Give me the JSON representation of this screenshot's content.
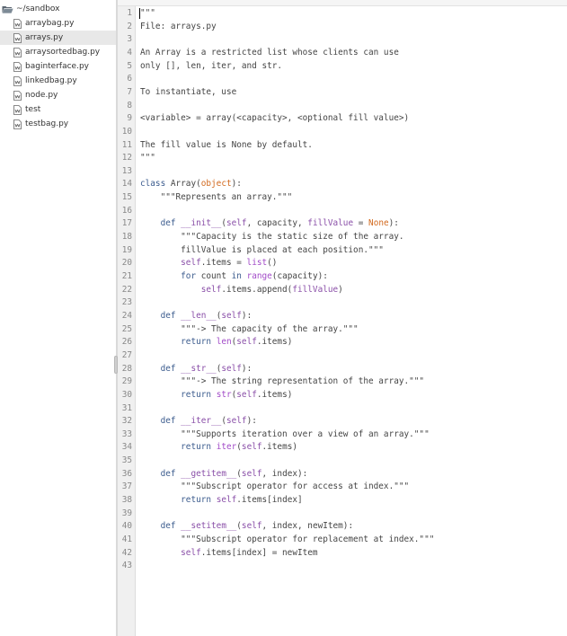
{
  "sidebar": {
    "root": "~/sandbox",
    "files": [
      {
        "name": "arraybag.py",
        "selected": false
      },
      {
        "name": "arrays.py",
        "selected": true
      },
      {
        "name": "arraysortedbag.py",
        "selected": false
      },
      {
        "name": "baginterface.py",
        "selected": false
      },
      {
        "name": "linkedbag.py",
        "selected": false
      },
      {
        "name": "node.py",
        "selected": false
      },
      {
        "name": "test",
        "selected": false
      },
      {
        "name": "testbag.py",
        "selected": false
      }
    ]
  },
  "editor": {
    "lines": [
      "\"\"\"",
      "File: arrays.py",
      "",
      "An Array is a restricted list whose clients can use",
      "only [], len, iter, and str.",
      "",
      "To instantiate, use",
      "",
      "<variable> = array(<capacity>, <optional fill value>)",
      "",
      "The fill value is None by default.",
      "\"\"\"",
      "",
      "class Array(object):",
      "    \"\"\"Represents an array.\"\"\"",
      "",
      "    def __init__(self, capacity, fillValue = None):",
      "        \"\"\"Capacity is the static size of the array.",
      "        fillValue is placed at each position.\"\"\"",
      "        self.items = list()",
      "        for count in range(capacity):",
      "            self.items.append(fillValue)",
      "",
      "    def __len__(self):",
      "        \"\"\"-> The capacity of the array.\"\"\"",
      "        return len(self.items)",
      "",
      "    def __str__(self):",
      "        \"\"\"-> The string representation of the array.\"\"\"",
      "        return str(self.items)",
      "",
      "    def __iter__(self):",
      "        \"\"\"Supports iteration over a view of an array.\"\"\"",
      "        return iter(self.items)",
      "",
      "    def __getitem__(self, index):",
      "        \"\"\"Subscript operator for access at index.\"\"\"",
      "        return self.items[index]",
      "",
      "    def __setitem__(self, index, newItem):",
      "        \"\"\"Subscript operator for replacement at index.\"\"\"",
      "        self.items[index] = newItem",
      ""
    ]
  },
  "colors": {
    "keyword": "#3c5c8e",
    "function_name": "#8a4fa8",
    "builtin": "#a24bc8",
    "constant": "#d2691e",
    "selection": "#e8e8e8"
  },
  "icons": {
    "folder": "open-folder-icon",
    "file": "python-file-icon"
  }
}
